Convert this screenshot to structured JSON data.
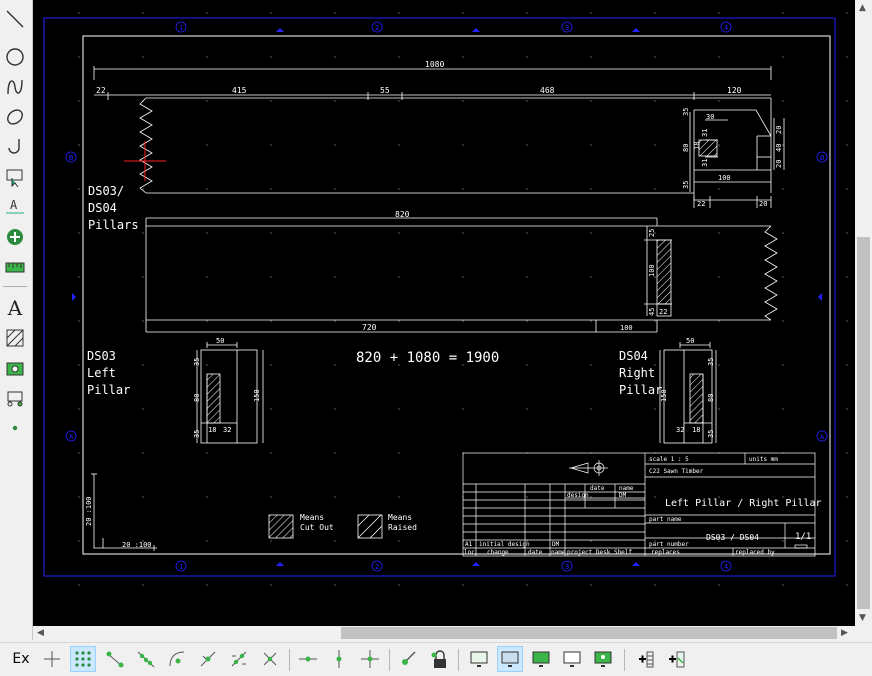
{
  "toolbar_left": {
    "text_tool_glyph": "A",
    "items": [
      "line-tool",
      "circle-tool",
      "spline-tool",
      "ellipse-tool",
      "arc-tool",
      "select-tool",
      "dimension-tool",
      "snap-tool",
      "measure-tool",
      "text-tool",
      "hatch-tool",
      "image-tool",
      "block-tool",
      "point-tool"
    ]
  },
  "toolbar_bottom": {
    "exit_label": "Ex"
  },
  "drawing": {
    "column_markers": [
      "1",
      "2",
      "3",
      "4",
      "5"
    ],
    "row_markers_left": [
      "B",
      "A"
    ],
    "row_markers_right": [
      "B",
      "A"
    ],
    "top_dims": {
      "overall": "1080",
      "seg_22": "22",
      "seg_415": "415",
      "seg_55": "55",
      "seg_468": "468",
      "seg_120": "120"
    },
    "detail_dims": {
      "d30": "30",
      "d35a": "35",
      "d80": "80",
      "d18": "18",
      "d31a": "31",
      "d31b": "31",
      "d20a": "20",
      "d40": "40",
      "d20b": "20",
      "d100": "100",
      "d35b": "35",
      "d22": "22",
      "d20c": "20"
    },
    "label_ds0304": [
      "DS03/",
      "DS04",
      "Pillars"
    ],
    "mid_dims": {
      "overall": "820",
      "bottom_720": "720",
      "bottom_100": "100",
      "side_25": "25",
      "side_100": "100",
      "side_45": "45",
      "side_22": "22"
    },
    "equation": "820 + 1080 = 1900",
    "left_pillar": {
      "label": [
        "DS03",
        "Left",
        "Pillar"
      ],
      "dims": {
        "w50": "50",
        "h35a": "35",
        "h80": "80",
        "h150": "150",
        "h35b": "35",
        "w18": "18",
        "w32": "32"
      }
    },
    "right_pillar": {
      "label": [
        "DS04",
        "Right",
        "Pillar"
      ],
      "dims": {
        "w50": "50",
        "h35a": "35",
        "h80": "80",
        "h150": "150",
        "h35b": "35",
        "w32": "32",
        "w18": "18"
      }
    },
    "scale_marks": {
      "vertical": "20 :100",
      "horizontal": "20 :100"
    },
    "legend": {
      "cut_out": [
        "Means",
        "Cut Out"
      ],
      "raised": [
        "Means",
        "Raised"
      ]
    },
    "title_block": {
      "scale": "scale  1 : 5",
      "units": "units  mm",
      "material": "C22 Sawn Timber",
      "date_hdr": "date",
      "name_hdr": "name",
      "design_hdr": "design",
      "name_val": "DM",
      "title": "Left Pillar / Right Pillar",
      "part_name": "part name",
      "part_number_hdr": "part number",
      "part_number": "DS03 / DS04",
      "sheet": "1/1",
      "rev_a1": "A1",
      "initial_design": "initial design",
      "rev_dm": "DM",
      "loc": "loc",
      "change": "change",
      "date": "date",
      "name": "name",
      "project": "project  Desk Shelf",
      "replaces": "replaces",
      "replaced_by": "replaced by"
    }
  }
}
